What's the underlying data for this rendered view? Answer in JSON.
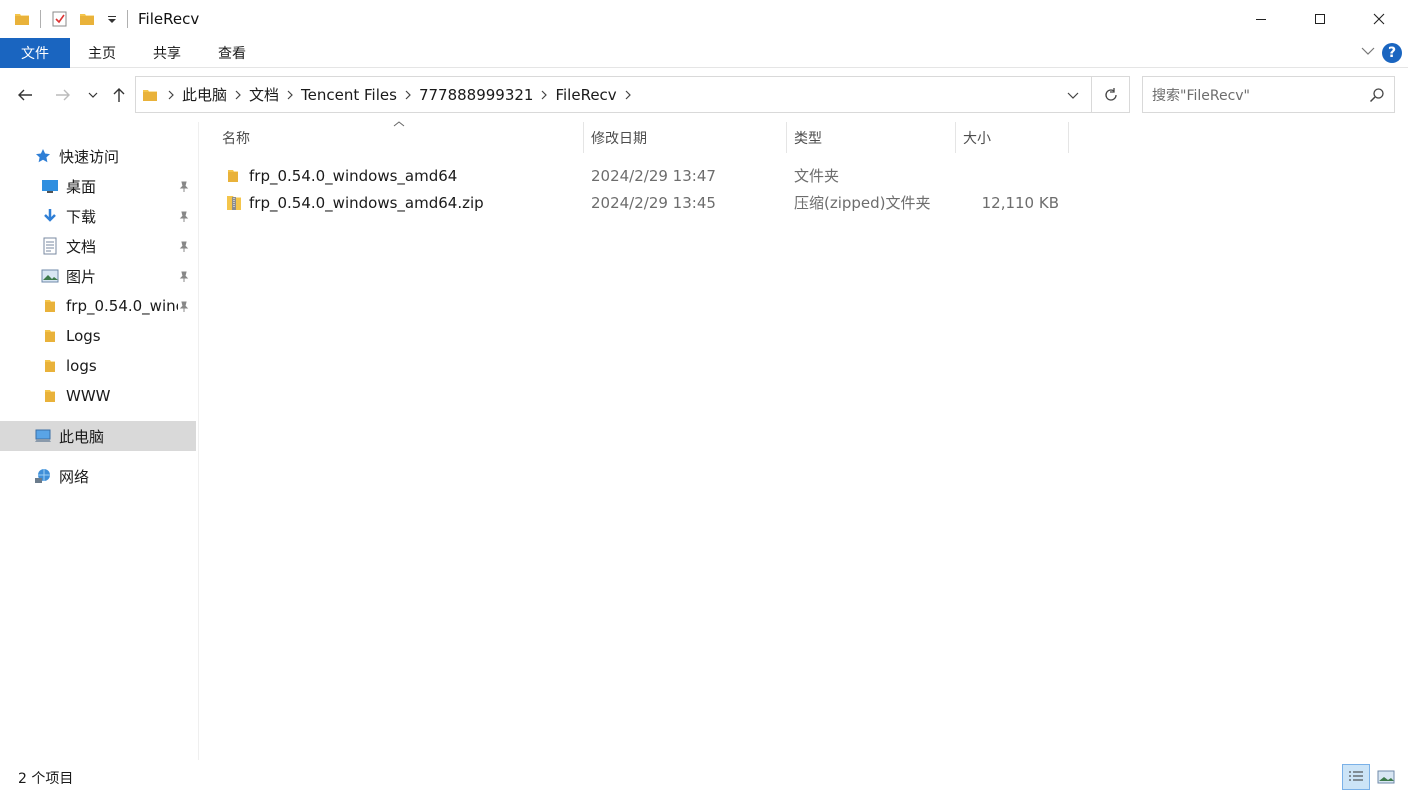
{
  "window": {
    "title": "FileRecv"
  },
  "ribbon": {
    "tabs": [
      "文件",
      "主页",
      "共享",
      "查看"
    ]
  },
  "address": {
    "crumbs": [
      "此电脑",
      "文档",
      "Tencent Files",
      "777888999321",
      "FileRecv"
    ]
  },
  "search": {
    "placeholder": "搜索\"FileRecv\""
  },
  "sidebar": {
    "quick_access": "快速访问",
    "items": [
      {
        "label": "桌面",
        "icon": "desktop-icon",
        "pinned": true
      },
      {
        "label": "下载",
        "icon": "download-icon",
        "pinned": true
      },
      {
        "label": "文档",
        "icon": "documents-icon",
        "pinned": true
      },
      {
        "label": "图片",
        "icon": "pictures-icon",
        "pinned": true
      },
      {
        "label": "frp_0.54.0_winc",
        "icon": "folder-icon",
        "pinned": true
      },
      {
        "label": "Logs",
        "icon": "folder-icon",
        "pinned": false
      },
      {
        "label": "logs",
        "icon": "folder-icon",
        "pinned": false
      },
      {
        "label": "WWW",
        "icon": "folder-icon",
        "pinned": false
      }
    ],
    "this_pc": "此电脑",
    "network": "网络"
  },
  "columns": {
    "name": "名称",
    "modified": "修改日期",
    "type": "类型",
    "size": "大小"
  },
  "files": [
    {
      "name": "frp_0.54.0_windows_amd64",
      "modified": "2024/2/29 13:47",
      "type": "文件夹",
      "size": "",
      "icon": "folder-icon"
    },
    {
      "name": "frp_0.54.0_windows_amd64.zip",
      "modified": "2024/2/29 13:45",
      "type": "压缩(zipped)文件夹",
      "size": "12,110 KB",
      "icon": "zip-folder-icon"
    }
  ],
  "status": {
    "item_count": "2 个项目"
  },
  "colors": {
    "accent": "#1a65c0",
    "folder": "#f4c54b",
    "selected_bg": "#d9d9d9"
  }
}
